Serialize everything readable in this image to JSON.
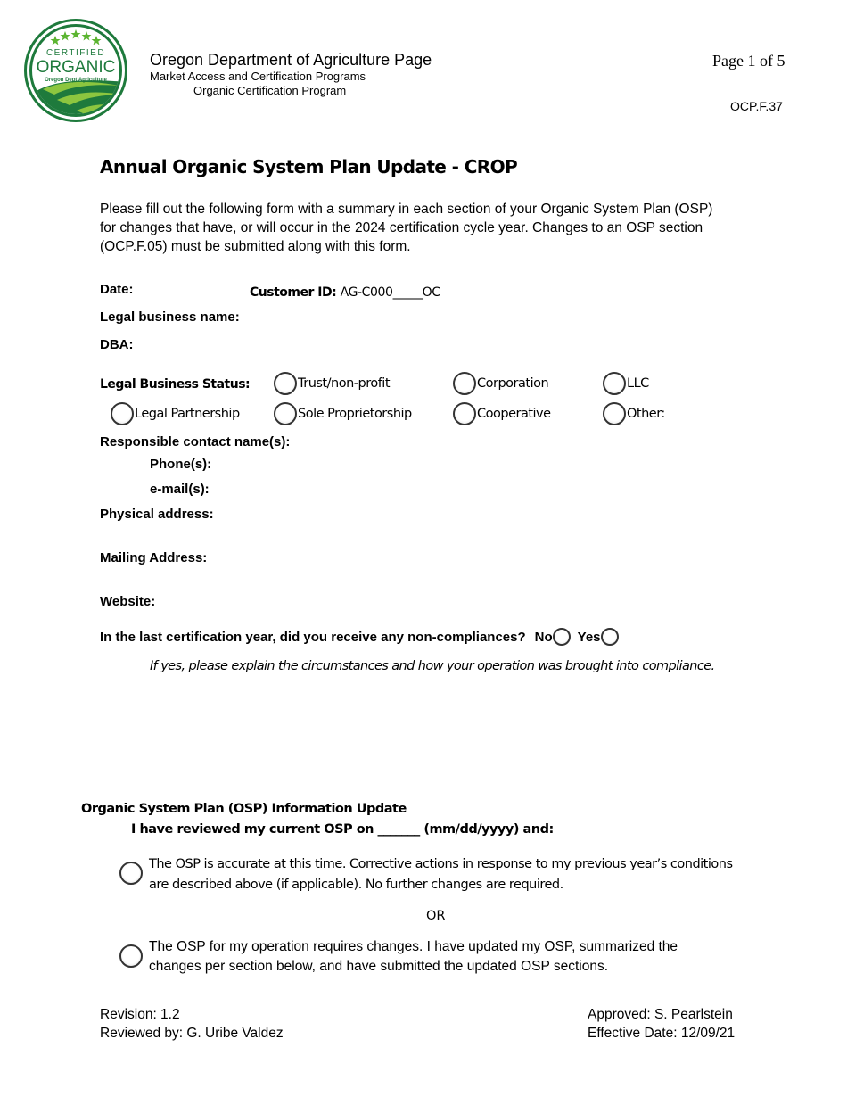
{
  "logo": {
    "top_text": "CERTIFIED",
    "main_text": "ORGANIC",
    "sub_text": "Oregon Dept Agriculture",
    "colors": {
      "dark_green": "#1e7a3c",
      "light_green": "#8cc63f",
      "star_green": "#5cb531"
    }
  },
  "header": {
    "title": "Oregon Department of Agriculture Page",
    "subtitle1": "Market Access and Certification Programs",
    "subtitle2": "Organic Certification Program",
    "page_number": "Page 1 of 5",
    "form_code": "OCP.F.37"
  },
  "document": {
    "title": "Annual Organic System Plan Update  - CROP",
    "intro": "Please fill out the following form with a summary in each section of your Organic System Plan (OSP) for changes that have, or will occur in the 2024 certification cycle year. Changes to an OSP section (OCP.F.05) must be submitted along with this form."
  },
  "fields": {
    "date_label": "Date:",
    "customer_id_label": "Customer ID:",
    "customer_id_value": "AG-C000_____OC",
    "legal_business_name_label": "Legal business name:",
    "dba_label": "DBA:",
    "legal_business_status_label": "Legal Business Status:",
    "responsible_contact_label": "Responsible contact name(s):",
    "phone_label": "Phone(s):",
    "email_label": "e-mail(s):",
    "physical_address_label": "Physical address:",
    "mailing_address_label": "Mailing Address:",
    "website_label": "Website:"
  },
  "business_status_options": [
    {
      "label": "Trust/non-profit",
      "selected": false
    },
    {
      "label": "Corporation",
      "selected": false
    },
    {
      "label": "LLC",
      "selected": false
    },
    {
      "label": "Legal Partnership",
      "selected": false
    },
    {
      "label": "Sole Proprietorship",
      "selected": false
    },
    {
      "label": "Cooperative",
      "selected": false
    },
    {
      "label": "Other:",
      "selected": false
    }
  ],
  "noncompliance": {
    "question": "In the last certification year, did you receive any  non-compliances?",
    "no_label": "No",
    "yes_label": "Yes",
    "explain": "If yes, please explain the circumstances and how your operation was brought into compliance."
  },
  "osp_update": {
    "heading": "Organic System Plan (OSP) Information Update",
    "review_line": "I have reviewed my current OSP on _______ (mm/dd/yyyy) and:",
    "option1": "The OSP is accurate at this time. Corrective actions in response to my previous year’s conditions are described above (if applicable). No further changes are required.",
    "or_label": "OR",
    "option2": "The OSP for my operation requires changes. I have updated my OSP, summarized the changes per section below, and have submitted the updated OSP sections."
  },
  "footer": {
    "revision": "Revision: 1.2",
    "reviewed_by": "Reviewed by: G. Uribe Valdez",
    "approved": "Approved: S. Pearlstein",
    "effective_date": "Effective Date: 12/09/21"
  }
}
